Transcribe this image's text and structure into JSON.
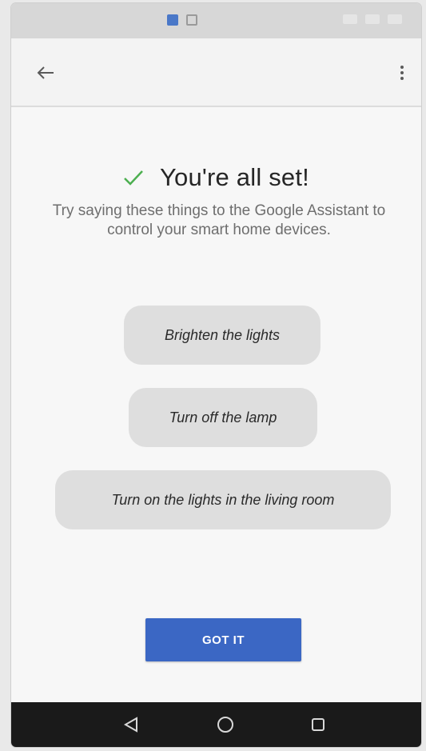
{
  "status_bar": {
    "icons": [
      "notification-icon",
      "image-icon",
      "signal-icon",
      "wifi-icon",
      "battery-icon"
    ]
  },
  "app_bar": {
    "back_icon": "arrow-left-icon",
    "more_icon": "more-vert-icon"
  },
  "content": {
    "title": "You're all set!",
    "subtitle": "Try saying these things to the Google Assistant to control your smart home devices.",
    "suggestions": [
      "Brighten the lights",
      "Turn off the lamp",
      "Turn on the lights in the living room"
    ],
    "confirm_button": "GOT IT"
  },
  "nav_bar": {
    "icons": [
      "triangle-back-icon",
      "circle-home-icon",
      "square-recents-icon"
    ]
  },
  "colors": {
    "accent": "#3b67c4",
    "check": "#4caf50",
    "chip": "#dedede",
    "nav": "#1a1a1a"
  }
}
